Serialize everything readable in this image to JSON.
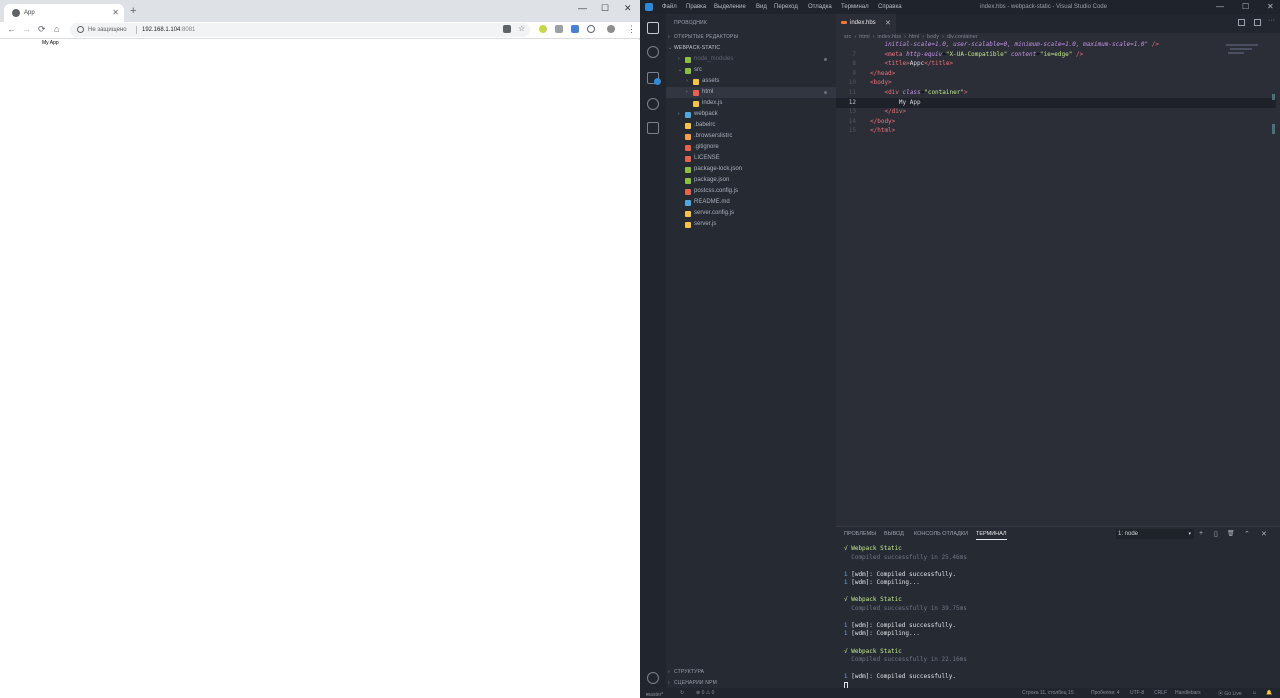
{
  "browser": {
    "tab_title": "App",
    "tab_close": "✕",
    "new_tab": "+",
    "window_controls": [
      "—",
      "☐",
      "✕"
    ],
    "address": {
      "security_label": "Не защищено",
      "host": "192.168.1.104",
      "port": ":8081"
    },
    "nav": {
      "back": "←",
      "forward": "→",
      "reload": "⟳",
      "home": "⌂",
      "star": "☆",
      "menu": "⋮"
    },
    "page_text": "My App"
  },
  "vscode": {
    "menu": [
      "Файл",
      "Правка",
      "Выделение",
      "Вид",
      "Переход",
      "Отладка",
      "Терминал",
      "Справка"
    ],
    "window_title": "index.hbs - webpack-static - Visual Studio Code",
    "window_controls": [
      "—",
      "☐",
      "✕"
    ],
    "explorer": {
      "title": "ПРОВОДНИК",
      "open_editors": "ОТКРЫТЫЕ РЕДАКТОРЫ",
      "project": "WEBPACK-STATIC",
      "items": [
        {
          "label": "node_modules",
          "icon": "folder-icon",
          "color": "#8fbf3f",
          "dim": true,
          "chev": "›",
          "indent": 0
        },
        {
          "label": "src",
          "icon": "folder-src-icon",
          "color": "#8fbf3f",
          "chev": "⌄",
          "indent": 0
        },
        {
          "label": "assets",
          "icon": "folder-icon",
          "color": "#f6c344",
          "chev": "›",
          "indent": 1
        },
        {
          "label": "html",
          "icon": "folder-html-icon",
          "color": "#e5634d",
          "chev": "›",
          "indent": 1,
          "selected": true
        },
        {
          "label": "index.js",
          "icon": "js-file-icon",
          "color": "#f6c344",
          "indent": 1
        },
        {
          "label": "webpack",
          "icon": "folder-webpack-icon",
          "color": "#4fa8e0",
          "chev": "›",
          "indent": 0
        },
        {
          "label": ".babelrc",
          "icon": "babel-file-icon",
          "color": "#f6c344",
          "indent": 0
        },
        {
          "label": ".browserslistrc",
          "icon": "browserslist-file-icon",
          "color": "#f6a04d",
          "indent": 0
        },
        {
          "label": ".gitignore",
          "icon": "git-file-icon",
          "color": "#e5634d",
          "indent": 0
        },
        {
          "label": "LICENSE",
          "icon": "license-file-icon",
          "color": "#e5634d",
          "indent": 0
        },
        {
          "label": "package-lock.json",
          "icon": "npm-file-icon",
          "color": "#8fbf3f",
          "indent": 0
        },
        {
          "label": "package.json",
          "icon": "npm-file-icon",
          "color": "#8fbf3f",
          "indent": 0
        },
        {
          "label": "postcss.config.js",
          "icon": "postcss-file-icon",
          "color": "#e5634d",
          "indent": 0
        },
        {
          "label": "README.md",
          "icon": "readme-file-icon",
          "color": "#4fa8e0",
          "indent": 0
        },
        {
          "label": "server.config.js",
          "icon": "js-file-icon",
          "color": "#f6c344",
          "indent": 0
        },
        {
          "label": "server.js",
          "icon": "js-file-icon",
          "color": "#f6c344",
          "indent": 0
        }
      ],
      "outline": "СТРУКТУРА",
      "npm_scripts": "СЦЕНАРИИ NPM"
    },
    "editor": {
      "tab": "index.hbs",
      "tab_close": "✕",
      "breadcrumbs": [
        "src",
        "›",
        "html",
        "›",
        "index.hbs",
        "›",
        "html",
        "›",
        "body",
        "›",
        "div.container"
      ],
      "lines": [
        {
          "n": "",
          "html": "    <span class='t-attr'>initial-scale=1.0, user-scalable=0, minimum-scale=1.0, maximum-scale=1.0\"</span> <span class='t-tag'>/&gt;</span>"
        },
        {
          "n": "7",
          "html": "    <span class='t-tag'>&lt;meta</span> <span class='t-attr'>http-equiv</span>=<span class='t-str'>\"X-UA-Compatible\"</span> <span class='t-attr'>content</span>=<span class='t-str'>\"ie=edge\"</span> <span class='t-tag'>/&gt;</span>"
        },
        {
          "n": "8",
          "html": "    <span class='t-tag'>&lt;title&gt;</span><span class='t-txt'>Appc</span><span class='t-tag'>&lt;/title&gt;</span>"
        },
        {
          "n": "9",
          "html": "<span class='t-tag'>&lt;/head&gt;</span>"
        },
        {
          "n": "10",
          "html": "<span class='t-tag'>&lt;body&gt;</span>"
        },
        {
          "n": "11",
          "html": "    <span class='t-tag'>&lt;div</span> <span class='t-attr'>class</span>=<span class='t-str'>\"container\"</span><span class='t-tag'>&gt;</span>"
        },
        {
          "n": "12",
          "html": "        <span class='t-txt'>My App</span>",
          "current": true
        },
        {
          "n": "13",
          "html": "    <span class='t-tag'>&lt;/div&gt;</span>"
        },
        {
          "n": "14",
          "html": "<span class='t-tag'>&lt;/body&gt;</span>"
        },
        {
          "n": "15",
          "html": "<span class='t-tag'>&lt;/html&gt;</span>"
        }
      ]
    },
    "panel": {
      "tabs": [
        "ПРОБЛЕМЫ",
        "ВЫВОД",
        "КОНСОЛЬ ОТЛАДКИ",
        "ТЕРМИНАЛ"
      ],
      "active_tab": 3,
      "terminal_select": "1: node",
      "dropdown": "▾",
      "icons": [
        "+",
        "▯",
        "🗑",
        "⌃",
        "✕"
      ],
      "lines": [
        {
          "cls": "t-ok",
          "text": "√ Webpack Static"
        },
        {
          "cls": "t-dim",
          "text": "  Compiled successfully in 25.46ms"
        },
        {
          "cls": "",
          "text": ""
        },
        {
          "cls": "t-info",
          "text": "i",
          "rest": " [wdm]: Compiled successfully."
        },
        {
          "cls": "t-info",
          "text": "i",
          "rest": " [wdm]: Compiling..."
        },
        {
          "cls": "",
          "text": ""
        },
        {
          "cls": "t-ok",
          "text": "√ Webpack Static"
        },
        {
          "cls": "t-dim",
          "text": "  Compiled successfully in 39.75ms"
        },
        {
          "cls": "",
          "text": ""
        },
        {
          "cls": "t-info",
          "text": "i",
          "rest": " [wdm]: Compiled successfully."
        },
        {
          "cls": "t-info",
          "text": "i",
          "rest": " [wdm]: Compiling..."
        },
        {
          "cls": "",
          "text": ""
        },
        {
          "cls": "t-ok",
          "text": "√ Webpack Static"
        },
        {
          "cls": "t-dim",
          "text": "  Compiled successfully in 22.16ms"
        },
        {
          "cls": "",
          "text": ""
        },
        {
          "cls": "t-info",
          "text": "i",
          "rest": " [wdm]: Compiled successfully."
        }
      ]
    },
    "status": {
      "branch": "master*",
      "sync": "↻",
      "problems": "⊗ 0 ⚠ 0",
      "branch_label": "⑂",
      "position": "Строка 11, столбец 15",
      "spaces": "Пробелов: 4",
      "encoding": "UTF-8",
      "eol": "CRLF",
      "language": "Handlebars",
      "golive": "⦿ Go Live",
      "feedback": "☺",
      "bell": "🔔"
    }
  }
}
